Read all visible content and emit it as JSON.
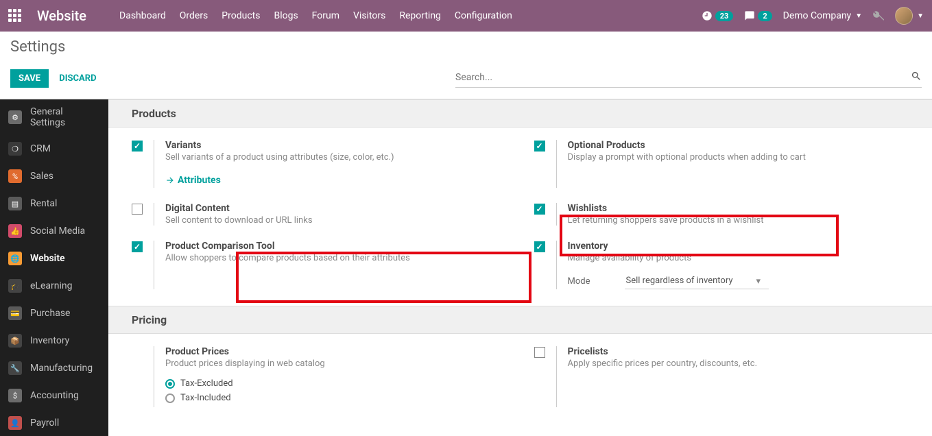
{
  "nav": {
    "brand": "Website",
    "items": [
      "Dashboard",
      "Orders",
      "Products",
      "Blogs",
      "Forum",
      "Visitors",
      "Reporting",
      "Configuration"
    ],
    "clock_badge": "23",
    "chat_badge": "2",
    "company": "Demo Company"
  },
  "cp": {
    "title": "Settings",
    "save": "SAVE",
    "discard": "DISCARD",
    "search_placeholder": "Search..."
  },
  "sidebar": {
    "items": [
      {
        "label": "General Settings",
        "icon": "⚙",
        "bg": "#6b6b6b"
      },
      {
        "label": "CRM",
        "icon": "❍",
        "bg": "#3a3a3a"
      },
      {
        "label": "Sales",
        "icon": "%",
        "bg": "#e06b2e"
      },
      {
        "label": "Rental",
        "icon": "▤",
        "bg": "#5a5a5a"
      },
      {
        "label": "Social Media",
        "icon": "👍",
        "bg": "#d14b6a"
      },
      {
        "label": "Website",
        "icon": "🌐",
        "bg": "#f79b34"
      },
      {
        "label": "eLearning",
        "icon": "🎓",
        "bg": "#444"
      },
      {
        "label": "Purchase",
        "icon": "💳",
        "bg": "#5a5a5a"
      },
      {
        "label": "Inventory",
        "icon": "📦",
        "bg": "#444"
      },
      {
        "label": "Manufacturing",
        "icon": "🔧",
        "bg": "#444"
      },
      {
        "label": "Accounting",
        "icon": "$",
        "bg": "#6b6b6b"
      },
      {
        "label": "Payroll",
        "icon": "👤",
        "bg": "#c0504d"
      }
    ],
    "active_index": 5
  },
  "sections": {
    "products": {
      "title": "Products",
      "variants": {
        "label": "Variants",
        "desc": "Sell variants of a product using attributes (size, color, etc.)",
        "checked": true,
        "link": "Attributes"
      },
      "optional": {
        "label": "Optional Products",
        "desc": "Display a prompt with optional products when adding to cart",
        "checked": true
      },
      "digital": {
        "label": "Digital Content",
        "desc": "Sell content to download or URL links",
        "checked": false
      },
      "wishlists": {
        "label": "Wishlists",
        "desc": "Let returning shoppers save products in a wishlist",
        "checked": true
      },
      "compare": {
        "label": "Product Comparison Tool",
        "desc": "Allow shoppers to compare products based on their attributes",
        "checked": true
      },
      "inventory": {
        "label": "Inventory",
        "desc": "Manage availability of products",
        "checked": true,
        "mode_label": "Mode",
        "mode_value": "Sell regardless of inventory"
      }
    },
    "pricing": {
      "title": "Pricing",
      "prices": {
        "label": "Product Prices",
        "desc": "Product prices displaying in web catalog",
        "opt1": "Tax-Excluded",
        "opt2": "Tax-Included"
      },
      "pricelists": {
        "label": "Pricelists",
        "desc": "Apply specific prices per country, discounts, etc.",
        "checked": false
      }
    }
  }
}
